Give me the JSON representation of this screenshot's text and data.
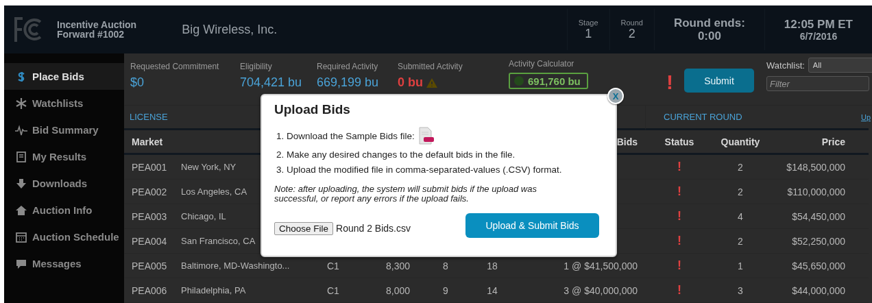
{
  "header": {
    "org_line1": "Incentive Auction",
    "org_line2": "Forward #1002",
    "bidder": "Big Wireless, Inc.",
    "stats": [
      {
        "label": "Stage",
        "value": "1"
      },
      {
        "label": "Round",
        "value": "2"
      }
    ],
    "round_ends": {
      "label": "Round ends:",
      "value": "0:00"
    },
    "clock": {
      "time": "12:05 PM ET",
      "date": "6/7/2016"
    }
  },
  "sidebar": {
    "items": [
      {
        "label": "Place Bids",
        "kind": "dollar",
        "selected": true
      },
      {
        "label": "Watchlists",
        "kind": "asterisk",
        "selected": false
      },
      {
        "label": "Bid Summary",
        "kind": "pulse",
        "selected": false
      },
      {
        "label": "My Results",
        "kind": "book",
        "selected": false
      },
      {
        "label": "Downloads",
        "kind": "download",
        "selected": false
      },
      {
        "label": "Auction Info",
        "kind": "home",
        "selected": false
      },
      {
        "label": "Auction Schedule",
        "kind": "calendar",
        "selected": false
      },
      {
        "label": "Messages",
        "kind": "chat",
        "selected": false
      }
    ]
  },
  "summary": {
    "metrics": [
      {
        "label": "Requested Commitment",
        "value": "$0",
        "kind": "plain"
      },
      {
        "label": "Eligibility",
        "value": "704,421 bu",
        "kind": "plain"
      },
      {
        "label": "Required Activity",
        "value": "669,199 bu",
        "kind": "plain"
      },
      {
        "label": "Submitted Activity",
        "value": "0 bu",
        "kind": "warning"
      }
    ],
    "activity_calculator": {
      "label": "Activity Calculator",
      "value": "691,760 bu"
    },
    "alert": "!",
    "submit_button": "Submit",
    "watchlist": {
      "label": "Watchlist:",
      "value": "All"
    },
    "filter": {
      "placeholder": "Filter"
    }
  },
  "table": {
    "groups": [
      "LICENSE",
      "CURRENT ROUND"
    ],
    "link": "Up",
    "columns": {
      "market": "Market",
      "bids": "Bids",
      "status": "Status",
      "quantity": "Quantity",
      "price": "Price"
    },
    "rows": [
      {
        "code": "PEA001",
        "market": "New York, NY",
        "status": "!",
        "quantity": "2",
        "price": "$148,500,000"
      },
      {
        "code": "PEA002",
        "market": "Los Angeles, CA",
        "status": "!",
        "quantity": "2",
        "price": "$110,000,000"
      },
      {
        "code": "PEA003",
        "market": "Chicago, IL",
        "status": "!",
        "quantity": "4",
        "price": "$54,450,000"
      },
      {
        "code": "PEA004",
        "market": "San Francisco, CA",
        "status": "!",
        "quantity": "2",
        "price": "$52,250,000"
      },
      {
        "code": "PEA005",
        "market": "Baltimore, MD-Washingto...",
        "column_3": "C1",
        "column_4": "8,300",
        "column_5": "8",
        "column_6": "18",
        "bids": "1 @ $41,500,000",
        "status": "!",
        "quantity": "1",
        "price": "$45,650,000"
      },
      {
        "code": "PEA006",
        "market": "Philadelphia, PA",
        "column_3": "C1",
        "column_4": "8,000",
        "column_5": "9",
        "column_6": "14",
        "bids": "3 @ $40,000,000",
        "status": "!",
        "quantity": "3",
        "price": "$44,000,000"
      }
    ]
  },
  "dialog": {
    "title": "Upload Bids",
    "steps": [
      {
        "text": "1. Download the Sample Bids file:",
        "file_icon": true
      },
      {
        "text": "2. Make any desired changes to the default bids in the file.",
        "file_icon": false
      },
      {
        "text": "3. Upload the modified file in comma-separated-values (.CSV) format.",
        "file_icon": false
      }
    ],
    "note": "Note: after uploading, the system will submit bids if the upload was successful, or report any errors if the upload fails.",
    "file_button": "Choose File",
    "file_name": "Round 2 Bids.csv",
    "primary_button": "Upload & Submit Bids",
    "close": "X"
  }
}
